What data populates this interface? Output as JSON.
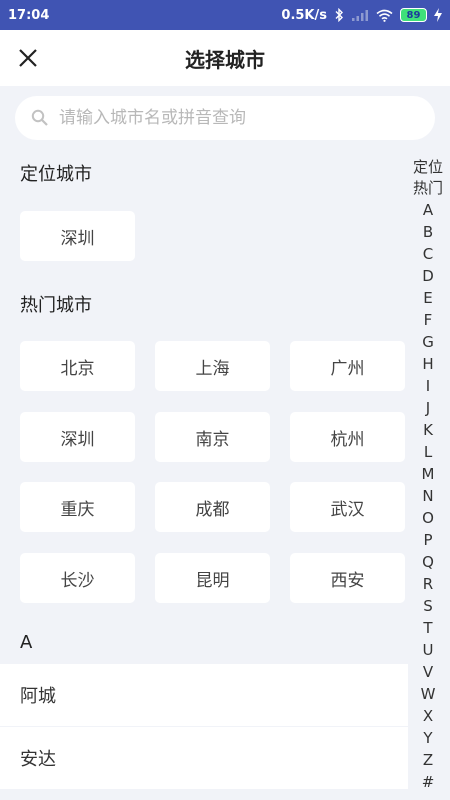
{
  "status_bar": {
    "time": "17:04",
    "net_speed": "0.5K/s",
    "battery": "89"
  },
  "header": {
    "title": "选择城市",
    "close_icon": "close-icon"
  },
  "search": {
    "placeholder": "请输入城市名或拼音查询",
    "value": ""
  },
  "located": {
    "title": "定位城市",
    "city": "深圳"
  },
  "hot": {
    "title": "热门城市",
    "cities": [
      "北京",
      "上海",
      "广州",
      "深圳",
      "南京",
      "杭州",
      "重庆",
      "成都",
      "武汉",
      "长沙",
      "昆明",
      "西安"
    ]
  },
  "list": {
    "header": "A",
    "items": [
      "阿城",
      "安达"
    ]
  },
  "index": {
    "items": [
      "定位",
      "热门",
      "A",
      "B",
      "C",
      "D",
      "E",
      "F",
      "G",
      "H",
      "I",
      "J",
      "K",
      "L",
      "M",
      "N",
      "O",
      "P",
      "Q",
      "R",
      "S",
      "T",
      "U",
      "V",
      "W",
      "X",
      "Y",
      "Z",
      "#"
    ]
  }
}
